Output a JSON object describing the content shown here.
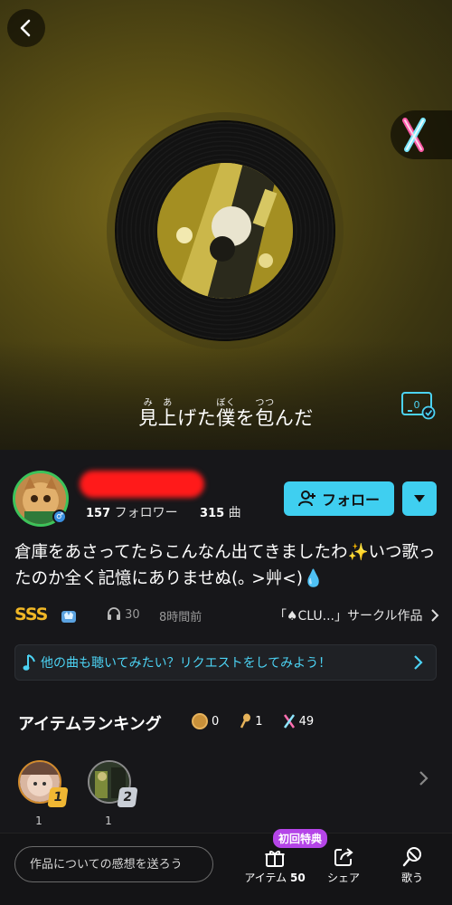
{
  "player": {
    "lyric_segments": [
      {
        "text": "見",
        "ruby": "み"
      },
      {
        "text": "上",
        "ruby": "あ"
      },
      {
        "text": "げた",
        "ruby": ""
      },
      {
        "text": "僕",
        "ruby": "ぼく"
      },
      {
        "text": "を",
        "ruby": ""
      },
      {
        "text": "包",
        "ruby": "つつ"
      },
      {
        "text": "んだ",
        "ruby": ""
      }
    ],
    "lyric_icon_count": "0"
  },
  "user": {
    "followers_count": "157",
    "followers_label": "フォロワー",
    "songs_count": "315",
    "songs_label": "曲"
  },
  "follow_button_label": "フォロー",
  "description": "倉庫をあさってたらこんなん出てきましたわ✨いつ歌ったのか全く記憶にありませぬ(｡ >艸<)💧",
  "meta": {
    "grade": "SSS",
    "listens": "30",
    "time_ago": "8時間前",
    "circle_link": "「♠CLU...」サークル作品"
  },
  "request_banner": "他の曲も聴いてみたい？リクエストをしてみよう！",
  "item_ranking": {
    "title": "アイテムランキング",
    "counts": {
      "coin": "0",
      "mic": "1",
      "lightstick": "49"
    },
    "rankers": [
      {
        "rank": "1",
        "count": "1"
      },
      {
        "rank": "2",
        "count": "1"
      }
    ]
  },
  "bottom_bar": {
    "comment_placeholder": "作品についての感想を送ろう",
    "first_badge": "初回特典",
    "item_label": "アイテム",
    "item_count": "50",
    "share_label": "シェア",
    "sing_label": "歌う"
  },
  "colors": {
    "accent": "#3fcff0",
    "grade_gold": "#f0b726",
    "badge_purple": "#b545e8"
  }
}
